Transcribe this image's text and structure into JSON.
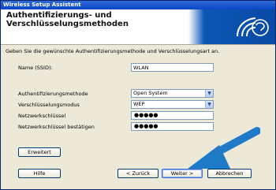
{
  "window": {
    "title": "Wireless Setup Assistent"
  },
  "header": {
    "title_line1": "Authentifizierungs- und",
    "title_line2": "Verschlüsselungsmethoden"
  },
  "intro": "Geben Sie die gewünschte Authentifizierungsmethode und Verschlüsselungsart an.",
  "ssid": {
    "label": "Name (SSID):",
    "value": "WLAN"
  },
  "auth": {
    "label": "Authentifizierungsmethode",
    "value": "Open System"
  },
  "enc": {
    "label": "Verschlüsselungsmodus",
    "value": "WEP"
  },
  "key": {
    "label": "Netzwerkschlüssel",
    "value": "●●●●●"
  },
  "key_confirm": {
    "label": "Netzwerkschlüssel bestätigen",
    "value": "●●●●●"
  },
  "buttons": {
    "advanced": "Erweitert",
    "help": "Hilfe",
    "back": "< Zurück",
    "next": "Weiter >",
    "cancel": "Abbrechen"
  },
  "colors": {
    "title_bar": "#0a46c8",
    "logo_blue": "#0b57b5",
    "annotation_arrow": "#1f7ac8"
  },
  "icons": {
    "logo": "wifi-logo-icon",
    "dropdown": "chevron-down-icon",
    "callout": "pointer-arrow-icon"
  }
}
